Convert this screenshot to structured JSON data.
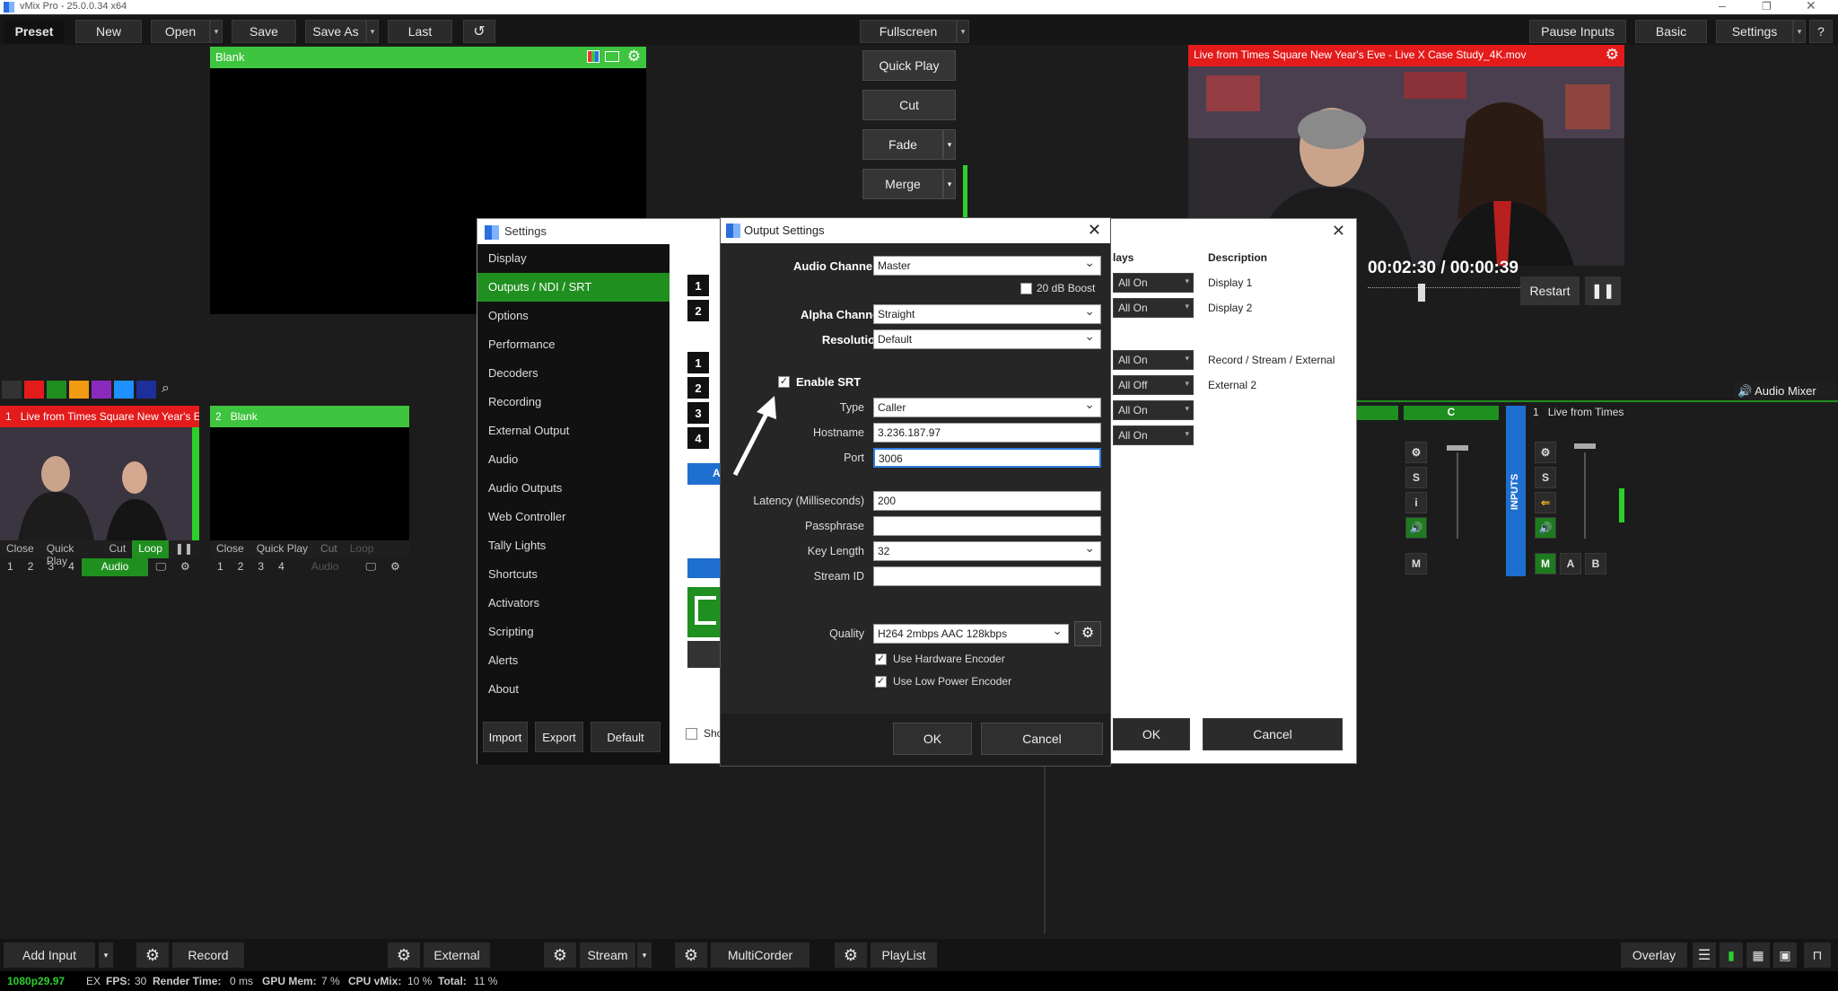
{
  "app": {
    "title": "vMix Pro - 25.0.0.34 x64"
  },
  "toolbar": {
    "preset": "Preset",
    "new": "New",
    "open": "Open",
    "save": "Save",
    "save_as": "Save As",
    "last": "Last",
    "fullscreen": "Fullscreen",
    "pause_inputs": "Pause Inputs",
    "basic": "Basic",
    "settings": "Settings",
    "help": "?"
  },
  "preview": {
    "title": "Blank"
  },
  "output": {
    "title": "Live from Times Square New Year's Eve - Live X Case Study_4K.mov",
    "time_elapsed": "00:02:30",
    "time_sep": "/",
    "time_remaining": "00:00:39",
    "restart": "Restart"
  },
  "transitions": {
    "quick_play": "Quick Play",
    "cut": "Cut",
    "fade": "Fade",
    "merge": "Merge"
  },
  "inputs": [
    {
      "num": "1",
      "title": "Live from Times Square New Year's E",
      "color": "#e41b1b",
      "loop": "Loop",
      "audio": "Audio"
    },
    {
      "num": "2",
      "title": "Blank",
      "color": "#3ec43e",
      "loop": "Loop",
      "audio": "Audio"
    }
  ],
  "input_controls": {
    "close": "Close",
    "quick_play": "Quick Play",
    "cut": "Cut",
    "n1": "1",
    "n2": "2",
    "n3": "3",
    "n4": "4"
  },
  "settings_window": {
    "title": "Settings",
    "items": [
      "Display",
      "Outputs / NDI / SRT",
      "Options",
      "Performance",
      "Decoders",
      "Recording",
      "External Output",
      "Audio",
      "Audio Outputs",
      "Web Controller",
      "Tally Lights",
      "Shortcuts",
      "Activators",
      "Scripting",
      "Alerts",
      "About"
    ],
    "import": "Import",
    "export": "Export",
    "default": "Default",
    "show": "Sho",
    "header_overlays": "lays",
    "header_description": "Description",
    "rows": [
      {
        "value": "All On",
        "desc": "Display 1"
      },
      {
        "value": "All On",
        "desc": "Display 2"
      },
      {
        "value": "All On",
        "desc": "Record / Stream / External"
      },
      {
        "value": "All Off",
        "desc": "External 2"
      },
      {
        "value": "All On",
        "desc": ""
      },
      {
        "value": "All On",
        "desc": ""
      }
    ],
    "ok": "OK",
    "cancel": "Cancel",
    "badges": [
      "1",
      "2",
      "1",
      "2",
      "3",
      "4"
    ]
  },
  "output_settings": {
    "title": "Output Settings",
    "audio_channels_label": "Audio Channels",
    "audio_channels": "Master",
    "boost_label": "20 dB Boost",
    "alpha_label": "Alpha Channel",
    "alpha": "Straight",
    "resolution_label": "Resolution",
    "resolution": "Default",
    "enable_srt_label": "Enable SRT",
    "type_label": "Type",
    "type": "Caller",
    "hostname_label": "Hostname",
    "hostname": "3.236.187.97",
    "port_label": "Port",
    "port": "3006",
    "latency_label": "Latency (Milliseconds)",
    "latency": "200",
    "passphrase_label": "Passphrase",
    "passphrase": "",
    "keylength_label": "Key Length",
    "keylength": "32",
    "streamid_label": "Stream ID",
    "streamid": "",
    "quality_label": "Quality",
    "quality": "H264 2mbps AAC 128kbps",
    "hw_encoder_label": "Use Hardware Encoder",
    "low_power_label": "Use Low Power Encoder",
    "ok": "OK",
    "cancel": "Cancel"
  },
  "mixer": {
    "audio_mixer": "Audio Mixer",
    "bus_c": "C",
    "inputs_label": "INPUTS",
    "ch1_num": "1",
    "ch1_name": "Live from Times",
    "s": "S",
    "i": "i",
    "m": "M",
    "a": "A",
    "b": "B"
  },
  "bottombar": {
    "add_input": "Add Input",
    "record": "Record",
    "external": "External",
    "stream": "Stream",
    "multicorder": "MultiCorder",
    "playlist": "PlayList",
    "overlay": "Overlay"
  },
  "status": {
    "format": "1080p29.97",
    "ex": "EX",
    "fps_label": "FPS:",
    "fps": "30",
    "render_label": "Render Time:",
    "render": "0 ms",
    "gpu_label": "GPU Mem:",
    "gpu": "7 %",
    "cpu_label": "CPU vMix:",
    "cpu": "10 %",
    "total_label": "Total:",
    "total": "11 %"
  },
  "colors": [
    "#e41b1b",
    "#1f8f1f",
    "#f29a11",
    "#8a2bbd",
    "#1e90ff",
    "#1d2f9a"
  ]
}
